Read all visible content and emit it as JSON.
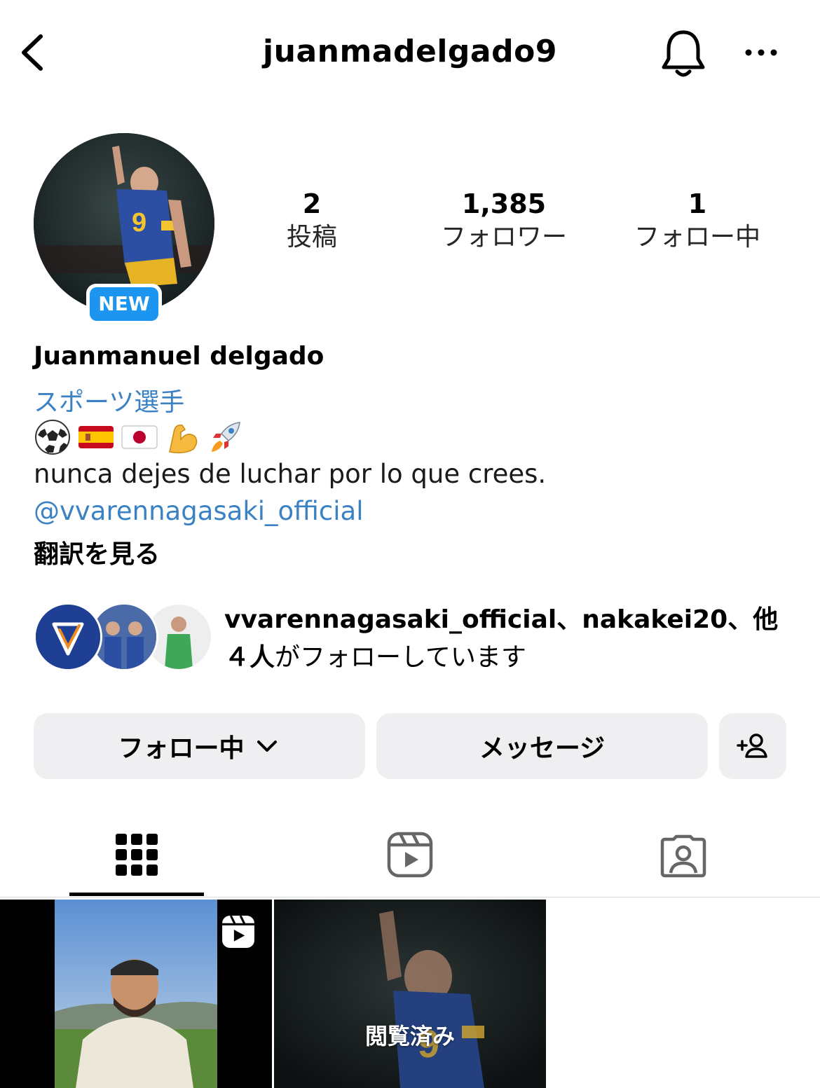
{
  "header": {
    "username": "juanmadelgado9",
    "back_icon": "chevron-left-icon",
    "bell_icon": "bell-icon",
    "more_icon": "more-horizontal-icon"
  },
  "profile": {
    "badge": "NEW",
    "stats": [
      {
        "value": "2",
        "label": "投稿"
      },
      {
        "value": "1,385",
        "label": "フォロワー"
      },
      {
        "value": "1",
        "label": "フォロー中"
      }
    ],
    "name": "Juanmanuel delgado",
    "category": "スポーツ選手",
    "emojis": [
      "soccer-ball",
      "spain-flag",
      "japan-flag",
      "flexed-biceps",
      "rocket"
    ],
    "bio": "nunca dejes de luchar por lo que  crees.",
    "mention": "@vvarennagasaki_official",
    "translate": "翻訳を見る",
    "link_color": "#3b82c4",
    "badge_color": "#1b95f0"
  },
  "followed_by": {
    "accounts": "vvarennagasaki_official、nakakei20、他",
    "count": "４人",
    "suffix": "がフォローしています"
  },
  "actions": {
    "following": "フォロー中",
    "message": "メッセージ",
    "add_user_icon": "add-person-icon"
  },
  "tabs": [
    {
      "name": "grid",
      "icon": "grid-icon",
      "active": true
    },
    {
      "name": "reels",
      "icon": "reels-icon",
      "active": false
    },
    {
      "name": "tagged",
      "icon": "tagged-person-icon",
      "active": false
    }
  ],
  "posts": [
    {
      "type": "reel",
      "overlay_icon": "reels-icon"
    },
    {
      "type": "photo",
      "overlay_text": "閲覧済み"
    }
  ]
}
